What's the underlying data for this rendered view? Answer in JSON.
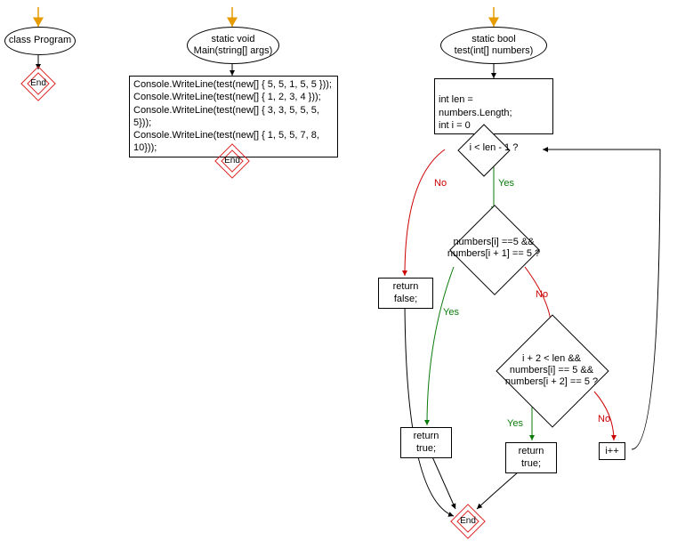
{
  "fc1": {
    "start_label": "class Program",
    "end_label": "End"
  },
  "fc2": {
    "start_label": "static void\nMain(string[] args)",
    "body_lines": [
      "Console.WriteLine(test(new[] { 5, 5, 1, 5, 5 }));",
      "Console.WriteLine(test(new[] { 1, 2, 3, 4 }));",
      "Console.WriteLine(test(new[] { 3, 3, 5, 5, 5, 5}));",
      "Console.WriteLine(test(new[] { 1, 5, 5, 7, 8, 10}));"
    ],
    "end_label": "End"
  },
  "fc3": {
    "start_label": "static bool\ntest(int[] numbers)",
    "init_label": "int len = numbers.Length;\nint i = 0",
    "cond1_label": "i < len - 1 ?",
    "cond2_label": "numbers[i] ==5 &&\nnumbers[i + 1] == 5 ?",
    "cond3_label": "i + 2 < len &&\nnumbers[i] == 5 &&\nnumbers[i + 2] == 5 ?",
    "return_false_label": "return false;",
    "return_true_label": "return true;",
    "return_true2_label": "return true;",
    "inc_label": "i++",
    "yes_label": "Yes",
    "no_label": "No",
    "end_label": "End"
  },
  "chart_data": {
    "type": "flowchart",
    "subcharts": [
      {
        "name": "class Program",
        "nodes": [
          {
            "id": "A_start",
            "kind": "terminator",
            "label": "class Program"
          },
          {
            "id": "A_end",
            "kind": "end",
            "label": "End"
          }
        ],
        "edges": [
          {
            "from": "A_start",
            "to": "A_end"
          }
        ]
      },
      {
        "name": "Main",
        "nodes": [
          {
            "id": "B_start",
            "kind": "terminator",
            "label": "static void Main(string[] args)"
          },
          {
            "id": "B_body",
            "kind": "process",
            "label": "Console.WriteLine(test(new[] { 5, 5, 1, 5, 5 })); Console.WriteLine(test(new[] { 1, 2, 3, 4 })); Console.WriteLine(test(new[] { 3, 3, 5, 5, 5, 5})); Console.WriteLine(test(new[] { 1, 5, 5, 7, 8, 10}));"
          },
          {
            "id": "B_end",
            "kind": "end",
            "label": "End"
          }
        ],
        "edges": [
          {
            "from": "B_start",
            "to": "B_body"
          },
          {
            "from": "B_body",
            "to": "B_end"
          }
        ]
      },
      {
        "name": "test",
        "nodes": [
          {
            "id": "C_start",
            "kind": "terminator",
            "label": "static bool test(int[] numbers)"
          },
          {
            "id": "C_init",
            "kind": "process",
            "label": "int len = numbers.Length; int i = 0"
          },
          {
            "id": "C_d1",
            "kind": "decision",
            "label": "i < len - 1 ?"
          },
          {
            "id": "C_d2",
            "kind": "decision",
            "label": "numbers[i] ==5 && numbers[i + 1] == 5 ?"
          },
          {
            "id": "C_d3",
            "kind": "decision",
            "label": "i + 2 < len && numbers[i] == 5 && numbers[i + 2] == 5 ?"
          },
          {
            "id": "C_rf",
            "kind": "process",
            "label": "return false;"
          },
          {
            "id": "C_rt1",
            "kind": "process",
            "label": "return true;"
          },
          {
            "id": "C_rt2",
            "kind": "process",
            "label": "return true;"
          },
          {
            "id": "C_inc",
            "kind": "process",
            "label": "i++"
          },
          {
            "id": "C_end",
            "kind": "end",
            "label": "End"
          }
        ],
        "edges": [
          {
            "from": "C_start",
            "to": "C_init"
          },
          {
            "from": "C_init",
            "to": "C_d1"
          },
          {
            "from": "C_d1",
            "to": "C_d2",
            "label": "Yes"
          },
          {
            "from": "C_d1",
            "to": "C_rf",
            "label": "No"
          },
          {
            "from": "C_d2",
            "to": "C_rt1",
            "label": "Yes"
          },
          {
            "from": "C_d2",
            "to": "C_d3",
            "label": "No"
          },
          {
            "from": "C_d3",
            "to": "C_rt2",
            "label": "Yes"
          },
          {
            "from": "C_d3",
            "to": "C_inc",
            "label": "No"
          },
          {
            "from": "C_inc",
            "to": "C_d1"
          },
          {
            "from": "C_rf",
            "to": "C_end"
          },
          {
            "from": "C_rt1",
            "to": "C_end"
          },
          {
            "from": "C_rt2",
            "to": "C_end"
          }
        ]
      }
    ]
  }
}
